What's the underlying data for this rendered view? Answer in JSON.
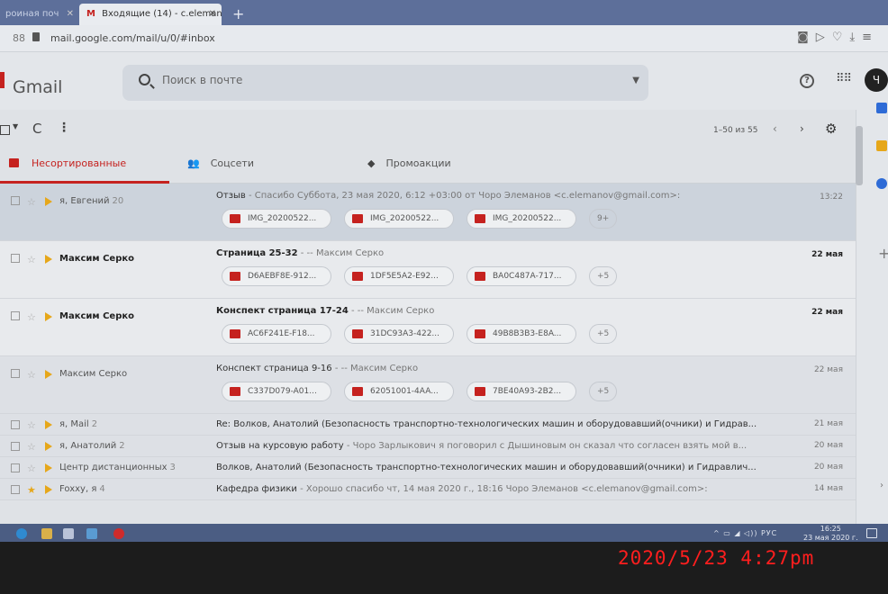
{
  "browser": {
    "tabs": [
      {
        "label": "роиная поч"
      },
      {
        "label": "Входящие (14) - c.elemanc"
      }
    ],
    "new_tab": "+",
    "close": "✕",
    "url": "mail.google.com/mail/u/0/#inbox"
  },
  "header": {
    "logo": "Gmail",
    "search_placeholder": "Поиск в почте",
    "avatar_letter": "Ч",
    "help": "?"
  },
  "toolbar": {
    "page_range": "1–50 из 55",
    "prev": "‹",
    "next": "›",
    "settings": "⚙",
    "refresh": "C",
    "more": "⋮"
  },
  "categories": [
    {
      "label": "Несортированные"
    },
    {
      "label": "Соцсети"
    },
    {
      "label": "Промоакции"
    }
  ],
  "emails": [
    {
      "sender": "я, Евгений",
      "count": "20",
      "subject": "Отзыв",
      "snippet": " - Спасибо Суббота, 23 мая 2020, 6:12 +03:00 от Чоро Элеманов <c.elemanov@gmail.com>:",
      "date": "13:22",
      "attachments": [
        "IMG_20200522...",
        "IMG_20200522...",
        "IMG_20200522..."
      ],
      "more": "9+"
    },
    {
      "sender": "Максим Серко",
      "count": "",
      "subject": "Страница 25-32",
      "snippet": " - -- Максим Серко",
      "date": "22 мая",
      "attachments": [
        "D6AEBF8E-912...",
        "1DF5E5A2-E92...",
        "BA0C487A-717..."
      ],
      "more": "+5"
    },
    {
      "sender": "Максим Серко",
      "count": "",
      "subject": "Конспект страница 17-24",
      "snippet": " - -- Максим Серко",
      "date": "22 мая",
      "attachments": [
        "AC6F241E-F18...",
        "31DC93A3-422...",
        "49B8B3B3-E8A..."
      ],
      "more": "+5"
    },
    {
      "sender": "Максим Серко",
      "count": "",
      "subject": "Конспект страница 9-16",
      "snippet": " - -- Максим Серко",
      "date": "22 мая",
      "attachments": [
        "C337D079-A01...",
        "62051001-4AA...",
        "7BE40A93-2B2..."
      ],
      "more": "+5"
    },
    {
      "sender": "я, Mail",
      "count": "2",
      "subject": "Re: Волков, Анатолий (Безопасность транспортно-технологических машин и оборудовавший(очники) и Гидрав...",
      "snippet": "",
      "date": "21 мая"
    },
    {
      "sender": "я, Анатолий",
      "count": "2",
      "subject": "Отзыв на курсовую работу",
      "snippet": " - Чоро Зарлыкович я поговорил с Дышиновым он сказал что согласен взять мой в...",
      "date": "20 мая"
    },
    {
      "sender": "Центр дистанционных",
      "count": "3",
      "subject": "Волков, Анатолий (Безопасность транспортно-технологических машин и оборудовавший(очники) и Гидравлич...",
      "snippet": "",
      "date": "20 мая"
    },
    {
      "sender": "Foxxy, я",
      "count": "4",
      "subject": "Кафедра физики",
      "snippet": " - Хорошо спасибо чт, 14 мая 2020 г., 18:16 Чоро Элеманов <c.elemanov@gmail.com>:",
      "date": "14 мая"
    }
  ],
  "taskbar": {
    "tray": "^ ▭ ◢ ◁)) РУС",
    "time": "16:25",
    "date": "23 мая 2020 г."
  },
  "camera_timestamp": "2020/5/23   4:27pm",
  "colors": {
    "accent": "#c5221f",
    "importance": "#e6a71a",
    "timestamp": "#ff1e1e"
  },
  "icons": [
    "search-icon",
    "settings-icon",
    "refresh-icon",
    "apps-icon",
    "help-icon",
    "star-icon",
    "importance-icon",
    "image-attachment-icon",
    "inbox-icon",
    "people-icon",
    "tag-icon"
  ]
}
